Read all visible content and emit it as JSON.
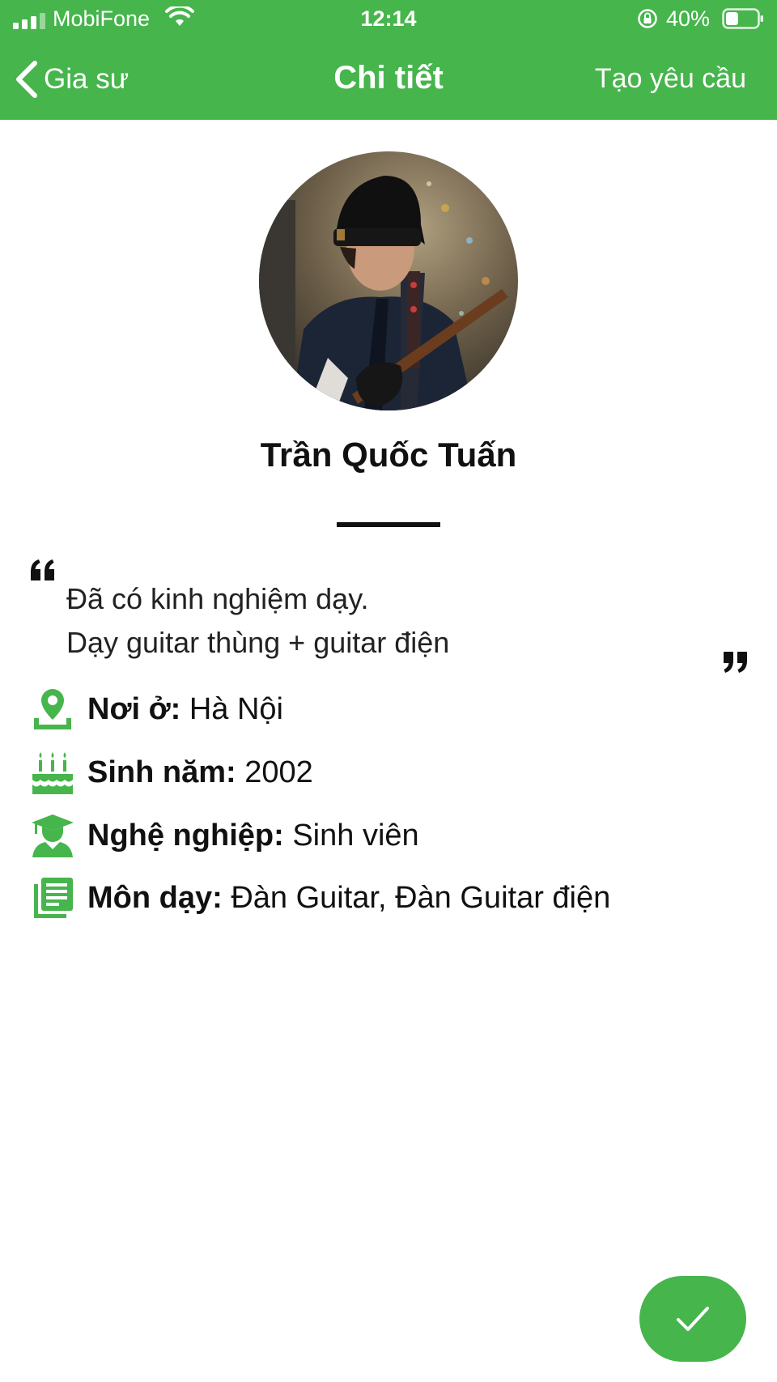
{
  "status_bar": {
    "carrier": "MobiFone",
    "time": "12:14",
    "battery": "40%",
    "battery_level": 0.4
  },
  "nav": {
    "back_label": "Gia sư",
    "title": "Chi tiết",
    "action_label": "Tạo yêu cầu"
  },
  "profile": {
    "name": "Trần Quốc Tuấn",
    "bio_lines": [
      "Đã có kinh nghiệm dạy.",
      "Dạy guitar thùng + guitar điện"
    ]
  },
  "details": [
    {
      "icon": "location-pin-icon",
      "label": "Nơi ở:",
      "value": "Hà Nội"
    },
    {
      "icon": "birthday-cake-icon",
      "label": "Sinh năm:",
      "value": "2002"
    },
    {
      "icon": "graduate-icon",
      "label": "Nghệ nghiệp:",
      "value": "Sinh viên"
    },
    {
      "icon": "subjects-book-icon",
      "label": "Môn dạy:",
      "value": "Đàn Guitar, Đàn Guitar điện"
    }
  ],
  "colors": {
    "brand_green": "#46b54c",
    "text": "#111111",
    "background": "#ffffff"
  }
}
